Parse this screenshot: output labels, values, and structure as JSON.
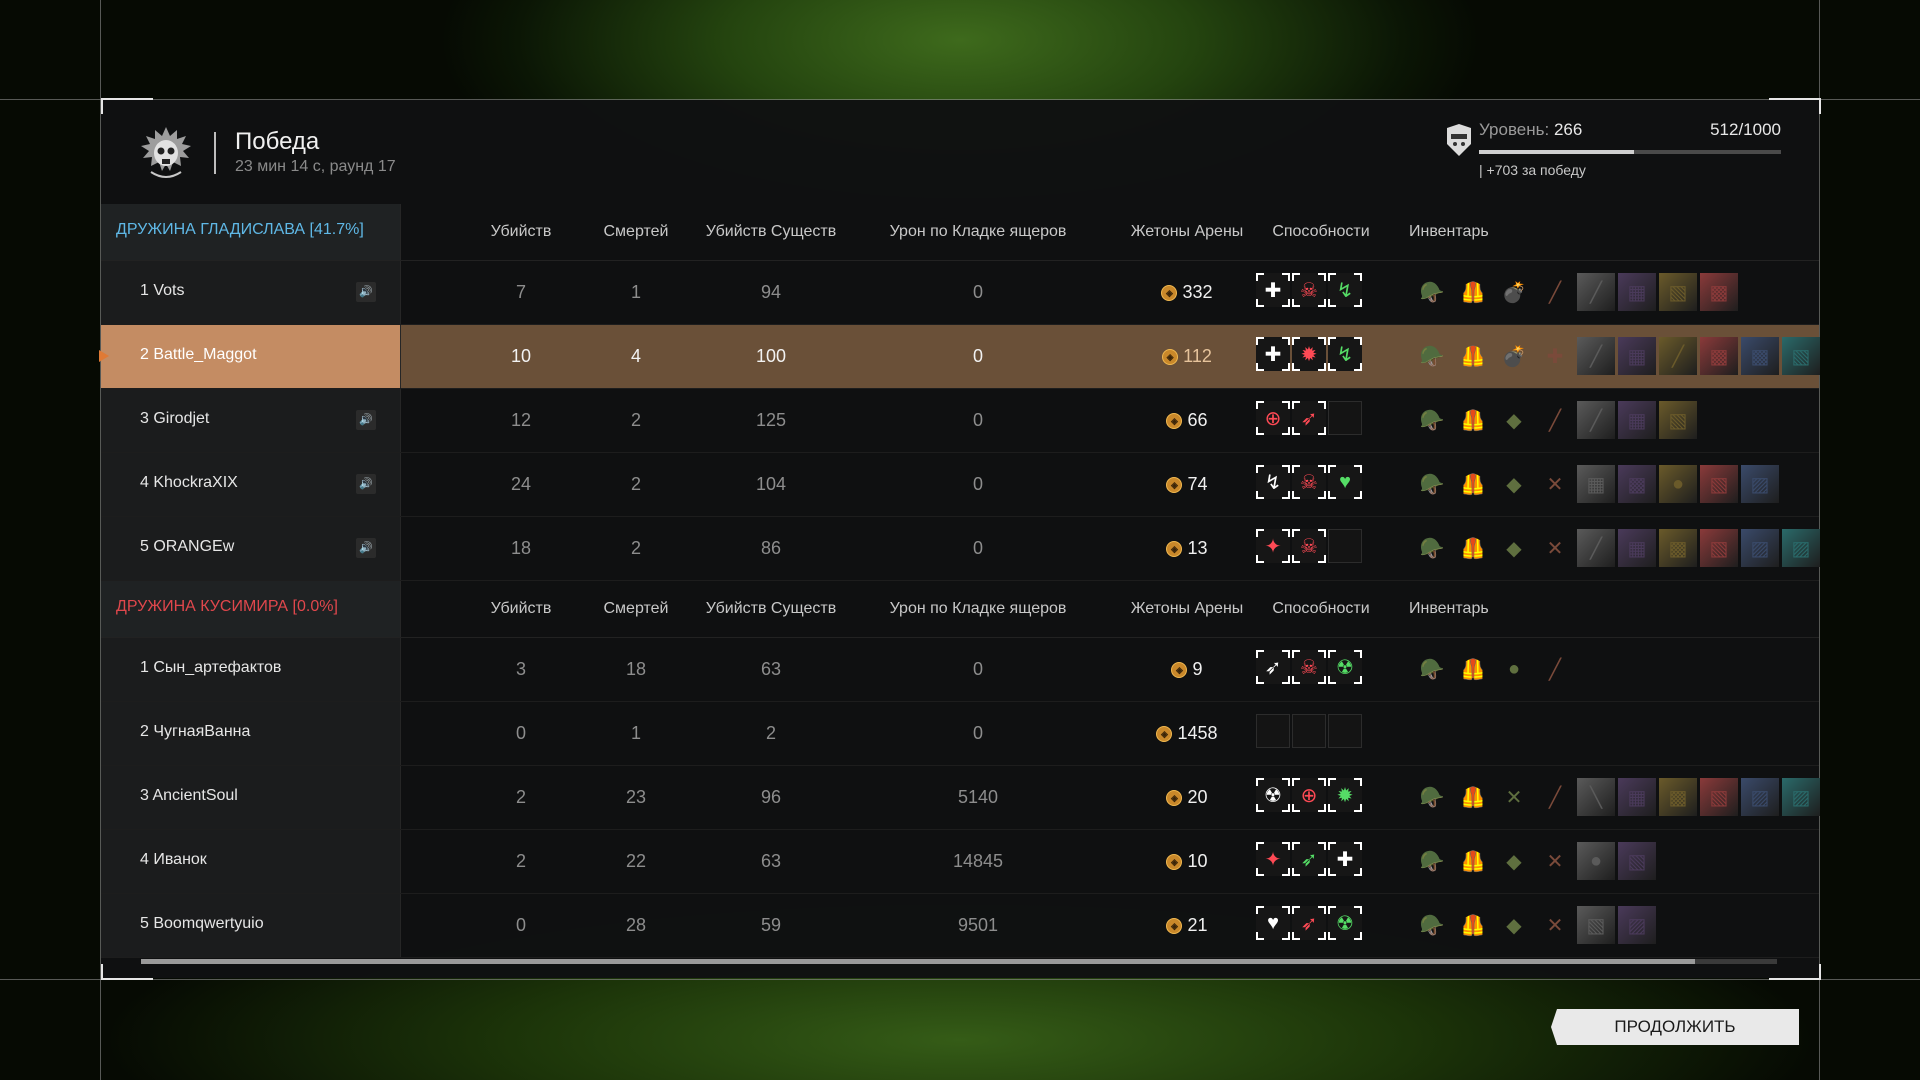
{
  "header": {
    "title": "Победа",
    "subtitle": "23 мин 14 с, раунд 17",
    "level_label": "Уровень:",
    "level_value": "266",
    "xp": "512/1000",
    "xp_progress": 0.512,
    "bonus": "| +703 за победу"
  },
  "columns": [
    "Убийств",
    "Смертей",
    "Убийств Существ",
    "Урон по Кладке ящеров",
    "Жетоны Арены",
    "Способности",
    "Инвентарь"
  ],
  "teams": [
    {
      "name": "ДРУЖИНА ГЛАДИСЛАВА [41.7%]",
      "color": "#5fb8e6",
      "players": [
        {
          "name": "1 Vots",
          "speaker": true,
          "kills": "7",
          "deaths": "1",
          "creature_kills": "94",
          "nest_damage": "0",
          "tokens": "332",
          "abilities": [
            {
              "g": "✚",
              "c": "#ffffff"
            },
            {
              "g": "☠",
              "c": "#ff4a55"
            },
            {
              "g": "↯",
              "c": "#55dd66"
            }
          ],
          "inventory": [
            "🪖",
            "🦺",
            "💣",
            "╱",
            "╱",
            "▦",
            "▧",
            "▩"
          ]
        },
        {
          "name": "2 Battle_Maggot",
          "speaker": false,
          "highlight": true,
          "kills": "10",
          "deaths": "4",
          "creature_kills": "100",
          "nest_damage": "0",
          "tokens": "112",
          "abilities": [
            {
              "g": "✚",
              "c": "#ffffff"
            },
            {
              "g": "✹",
              "c": "#ff4a55"
            },
            {
              "g": "↯",
              "c": "#55dd66"
            }
          ],
          "inventory": [
            "🪖",
            "🦺",
            "💣",
            "✚",
            "╱",
            "▦",
            "╱",
            "▩",
            "▩",
            "▧"
          ]
        },
        {
          "name": "3 Girodjet",
          "speaker": true,
          "kills": "12",
          "deaths": "2",
          "creature_kills": "125",
          "nest_damage": "0",
          "tokens": "66",
          "abilities": [
            {
              "g": "⊕",
              "c": "#ff4a55"
            },
            {
              "g": "➶",
              "c": "#ff4a55"
            },
            {
              "g": "",
              "c": ""
            }
          ],
          "inventory": [
            "🪖",
            "🦺",
            "◆",
            "╱",
            "╱",
            "▦",
            "▧"
          ]
        },
        {
          "name": "4 KhockraXIX",
          "speaker": true,
          "kills": "24",
          "deaths": "2",
          "creature_kills": "104",
          "nest_damage": "0",
          "tokens": "74",
          "abilities": [
            {
              "g": "↯",
              "c": "#ffffff"
            },
            {
              "g": "☠",
              "c": "#ff4a55"
            },
            {
              "g": "♥",
              "c": "#55dd66"
            }
          ],
          "inventory": [
            "🪖",
            "🦺",
            "◆",
            "✕",
            "▦",
            "▩",
            "●",
            "▧",
            "▨"
          ]
        },
        {
          "name": "5 ORANGEw",
          "speaker": true,
          "kills": "18",
          "deaths": "2",
          "creature_kills": "86",
          "nest_damage": "0",
          "tokens": "13",
          "abilities": [
            {
              "g": "✦",
              "c": "#ff4a55"
            },
            {
              "g": "☠",
              "c": "#ff4a55"
            },
            {
              "g": "",
              "c": ""
            }
          ],
          "inventory": [
            "🪖",
            "🦺",
            "◆",
            "✕",
            "╱",
            "▦",
            "▩",
            "▧",
            "▨",
            "▨"
          ]
        }
      ]
    },
    {
      "name": "ДРУЖИНА КУСИМИРА [0.0%]",
      "color": "#e0474c",
      "players": [
        {
          "name": "1 Сын_артефактов",
          "speaker": false,
          "kills": "3",
          "deaths": "18",
          "creature_kills": "63",
          "nest_damage": "0",
          "tokens": "9",
          "abilities": [
            {
              "g": "➶",
              "c": "#ffffff"
            },
            {
              "g": "☠",
              "c": "#ff4a55"
            },
            {
              "g": "☢",
              "c": "#55dd66"
            }
          ],
          "inventory": [
            "🪖",
            "🦺",
            "●",
            "╱"
          ]
        },
        {
          "name": "2 ЧугнаяВанна",
          "speaker": false,
          "kills": "0",
          "deaths": "1",
          "creature_kills": "2",
          "nest_damage": "0",
          "tokens": "1458",
          "abilities": [
            {
              "g": "",
              "c": ""
            },
            {
              "g": "",
              "c": ""
            },
            {
              "g": "",
              "c": ""
            }
          ],
          "inventory": []
        },
        {
          "name": "3 AncientSoul",
          "speaker": false,
          "kills": "2",
          "deaths": "23",
          "creature_kills": "96",
          "nest_damage": "5140",
          "tokens": "20",
          "abilities": [
            {
              "g": "☢",
              "c": "#ffffff"
            },
            {
              "g": "⊕",
              "c": "#ff4a55"
            },
            {
              "g": "✹",
              "c": "#55dd66"
            }
          ],
          "inventory": [
            "🪖",
            "🦺",
            "✕",
            "╱",
            "╲",
            "▦",
            "▩",
            "▧",
            "▨",
            "▨"
          ]
        },
        {
          "name": "4 Иванок",
          "speaker": false,
          "kills": "2",
          "deaths": "22",
          "creature_kills": "63",
          "nest_damage": "14845",
          "tokens": "10",
          "abilities": [
            {
              "g": "✦",
              "c": "#ff4a55"
            },
            {
              "g": "➶",
              "c": "#55dd66"
            },
            {
              "g": "✚",
              "c": "#ffffff"
            }
          ],
          "inventory": [
            "🪖",
            "🦺",
            "◆",
            "✕",
            "●",
            "▧"
          ]
        },
        {
          "name": "5 Boomqwertyuio",
          "speaker": false,
          "kills": "0",
          "deaths": "28",
          "creature_kills": "59",
          "nest_damage": "9501",
          "tokens": "21",
          "abilities": [
            {
              "g": "♥",
              "c": "#ffffff"
            },
            {
              "g": "➶",
              "c": "#ff4a55"
            },
            {
              "g": "☢",
              "c": "#55dd66"
            }
          ],
          "inventory": [
            "🪖",
            "🦺",
            "◆",
            "✕",
            "▧",
            "▨"
          ]
        }
      ]
    }
  ],
  "continue_label": "ПРОДОЛЖИТЬ",
  "colors": {
    "highlight_row": "#6a5038",
    "highlight_name": "#c48c63",
    "accent_orange": "#e07a35"
  }
}
